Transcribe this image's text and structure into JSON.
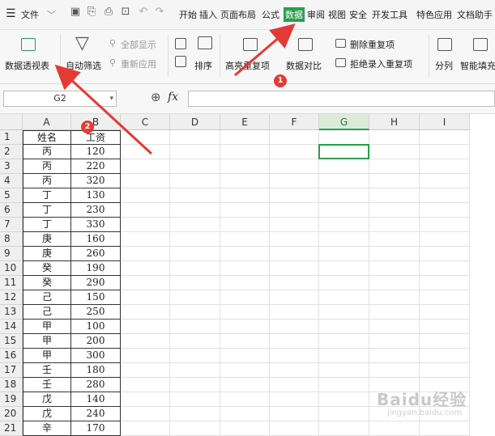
{
  "menubar": {
    "hamburger_file": "文件",
    "tabs": [
      "开始",
      "插入",
      "页面布局",
      "公式",
      "数据",
      "审阅",
      "视图",
      "安全",
      "开发工具",
      "特色应用",
      "文档助手"
    ]
  },
  "ribbon": {
    "pivot": "数据透视表",
    "autofilter": "自动筛选",
    "show_all": "全部显示",
    "reapply": "重新应用",
    "sort": "排序",
    "highlight_dup": "高亮重复项",
    "compare": "数据对比",
    "remove_dup": "删除重复项",
    "reject_dup": "拒绝录入重复项",
    "split": "分列",
    "smart_fill": "智能填充"
  },
  "formula_bar": {
    "cell_ref": "G2",
    "fx": "fx",
    "value": ""
  },
  "columns": [
    "A",
    "B",
    "C",
    "D",
    "E",
    "F",
    "G",
    "H",
    "I"
  ],
  "selected_column": "G",
  "rows": [
    {
      "n": "1",
      "a": "姓名",
      "b": "工资"
    },
    {
      "n": "2",
      "a": "丙",
      "b": "120"
    },
    {
      "n": "3",
      "a": "丙",
      "b": "220"
    },
    {
      "n": "4",
      "a": "丙",
      "b": "320"
    },
    {
      "n": "5",
      "a": "丁",
      "b": "130"
    },
    {
      "n": "6",
      "a": "丁",
      "b": "230"
    },
    {
      "n": "7",
      "a": "丁",
      "b": "330"
    },
    {
      "n": "8",
      "a": "庚",
      "b": "160"
    },
    {
      "n": "9",
      "a": "庚",
      "b": "260"
    },
    {
      "n": "10",
      "a": "癸",
      "b": "190"
    },
    {
      "n": "11",
      "a": "癸",
      "b": "290"
    },
    {
      "n": "12",
      "a": "己",
      "b": "150"
    },
    {
      "n": "13",
      "a": "己",
      "b": "250"
    },
    {
      "n": "14",
      "a": "甲",
      "b": "100"
    },
    {
      "n": "15",
      "a": "甲",
      "b": "200"
    },
    {
      "n": "16",
      "a": "甲",
      "b": "300"
    },
    {
      "n": "17",
      "a": "壬",
      "b": "180"
    },
    {
      "n": "18",
      "a": "壬",
      "b": "280"
    },
    {
      "n": "19",
      "a": "戊",
      "b": "140"
    },
    {
      "n": "20",
      "a": "戊",
      "b": "240"
    },
    {
      "n": "21",
      "a": "辛",
      "b": "170"
    }
  ],
  "annotations": {
    "badge1": "1",
    "badge2": "2",
    "arrow_color": "#e53935"
  },
  "watermark": {
    "logo": "Baidu经验",
    "url": "jingyan.baidu.com"
  },
  "colors": {
    "accent": "#2a9e4e",
    "arrow": "#e53935"
  }
}
